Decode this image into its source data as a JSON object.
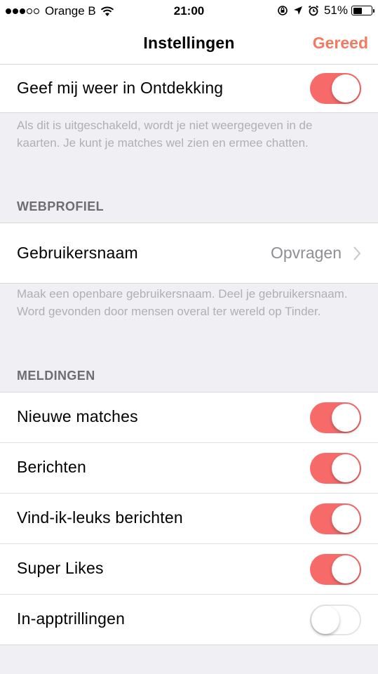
{
  "status_bar": {
    "carrier": "Orange B",
    "time": "21:00",
    "battery_percent": "51%",
    "battery_level": 0.51,
    "signal_bars_filled": 3,
    "signal_bars_total": 5
  },
  "nav": {
    "title": "Instellingen",
    "done_label": "Gereed",
    "accent_color": "#f37a62"
  },
  "discovery": {
    "label": "Geef mij weer in Ontdekking",
    "enabled": true,
    "footnote": "Als dit is uitgeschakeld, wordt je niet weergegeven in de kaarten. Je kunt je matches wel zien en ermee chatten."
  },
  "web_profile": {
    "header": "WEBPROFIEL",
    "username_label": "Gebruikersnaam",
    "username_value": "Opvragen",
    "footnote": "Maak een openbare gebruikersnaam. Deel je gebruikersnaam. Word gevonden door mensen overal ter wereld op Tinder."
  },
  "notifications": {
    "header": "MELDINGEN",
    "items": [
      {
        "label": "Nieuwe matches",
        "enabled": true
      },
      {
        "label": "Berichten",
        "enabled": true
      },
      {
        "label": "Vind-ik-leuks berichten",
        "enabled": true
      },
      {
        "label": "Super Likes",
        "enabled": true
      },
      {
        "label": "In-apptrillingen",
        "enabled": false
      }
    ]
  },
  "colors": {
    "toggle_on": "#f76a6a",
    "background": "#efeff4"
  }
}
